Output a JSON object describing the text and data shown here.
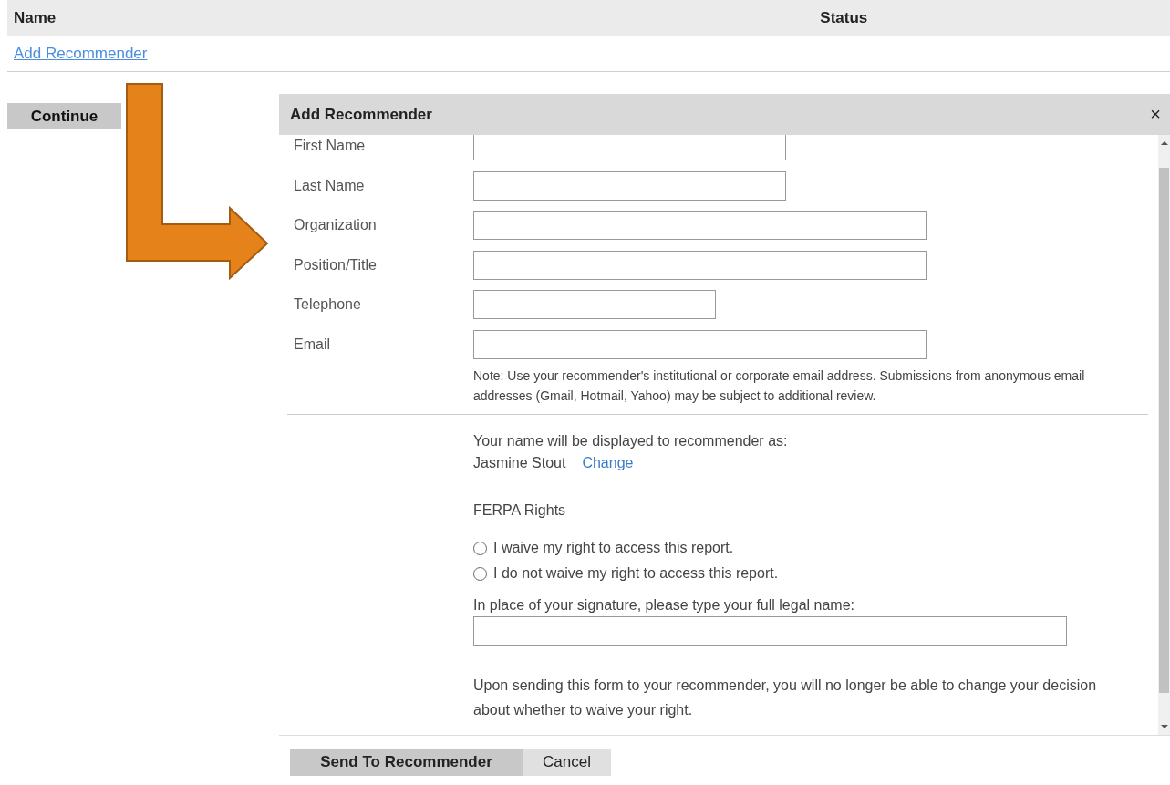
{
  "table": {
    "columns": [
      "Name",
      "Status"
    ],
    "link": "Add Recommender"
  },
  "continue_button": "Continue",
  "dialog": {
    "title": "Add Recommender",
    "close": "×",
    "fields": [
      {
        "label": "First Name"
      },
      {
        "label": "Last Name"
      },
      {
        "label": "Organization"
      },
      {
        "label": "Position/Title"
      },
      {
        "label": "Telephone"
      },
      {
        "label": "Email"
      }
    ],
    "note": "Note: Use your recommender's institutional or corporate email address. Submissions from anonymous email addresses (Gmail, Hotmail, Yahoo) may be subject to additional review.",
    "display_name_label": "Your name will be displayed to recommender as:",
    "display_name": "Jasmine Stout",
    "change_link": "Change",
    "ferpa_title": "FERPA Rights",
    "ferpa_options": [
      {
        "label": "I waive my right to access this report.",
        "selected": false
      },
      {
        "label": "I do not waive my right to access this report.",
        "selected": false
      }
    ],
    "signature_label": "In place of your signature, please type your full legal name:",
    "warning": "Upon sending this form to your recommender, you will no longer be able to change your decision about whether to waive your right.",
    "buttons": [
      {
        "label": "Send To Recommender",
        "kind": "primary"
      },
      {
        "label": "Cancel",
        "kind": "secondary"
      }
    ]
  }
}
